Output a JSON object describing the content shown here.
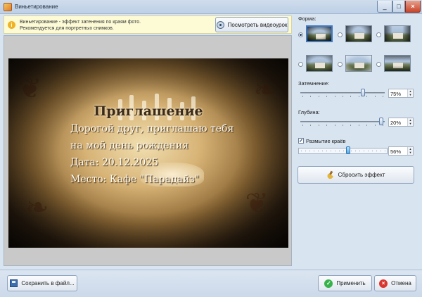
{
  "window": {
    "title": "Виньетирование"
  },
  "hint": {
    "line1": "Виньетирование - эффект затенения по краям фото.",
    "line2": "Рекомендуется для портретных снимков.",
    "video_button": "Посмотреть видеоурок"
  },
  "preview": {
    "heading": "Приглашение",
    "lines": [
      "Дорогой друг, приглашаю тебя",
      "на мой день рождения",
      "Дата: 20.12.2025",
      "Место: Кафе \"Парадайз\""
    ]
  },
  "panel": {
    "shape_label": "Форма:",
    "shapes_selected_index": 0,
    "darkening_label": "Затемнение:",
    "darkening_value": "75%",
    "darkening_level": 0.75,
    "depth_label": "Глубина:",
    "depth_value": "20%",
    "depth_level": 0.98,
    "blur_label": "Размытие краёв",
    "blur_checked": true,
    "blur_value": "56%",
    "blur_level": 0.56,
    "reset_button": "Сбросить эффект"
  },
  "footer": {
    "save_button": "Сохранить в файл...",
    "apply_button": "Применить",
    "cancel_button": "Отмена"
  },
  "colors": {
    "accent": "#3f78c4",
    "hint_bg": "#fdfbd6",
    "apply_icon": "#37b24a",
    "cancel_icon": "#d9362f"
  }
}
